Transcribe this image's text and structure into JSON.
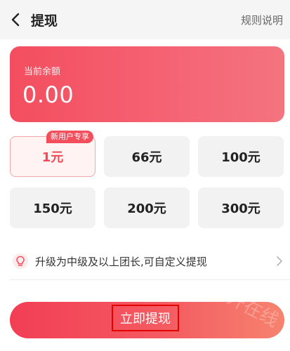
{
  "header": {
    "title": "提现",
    "rules_label": "规则说明"
  },
  "balance": {
    "label": "当前余额",
    "value": "0.00"
  },
  "amounts": [
    {
      "label": "1元",
      "selected": true,
      "badge": "新用户专享"
    },
    {
      "label": "66元"
    },
    {
      "label": "100元"
    },
    {
      "label": "150元"
    },
    {
      "label": "200元"
    },
    {
      "label": "300元"
    }
  ],
  "tip": {
    "text": "升级为中级及以上团长,可自定义提现"
  },
  "withdraw_button": {
    "label": "立即提现"
  },
  "watermark": "开在线",
  "colors": {
    "accent": "#f24e5c",
    "card_start": "#f34e5f",
    "card_end": "#f4747e"
  },
  "icons": {
    "back": "chevron-left-icon",
    "tip": "lightbulb-icon",
    "more": "chevron-right-icon"
  }
}
